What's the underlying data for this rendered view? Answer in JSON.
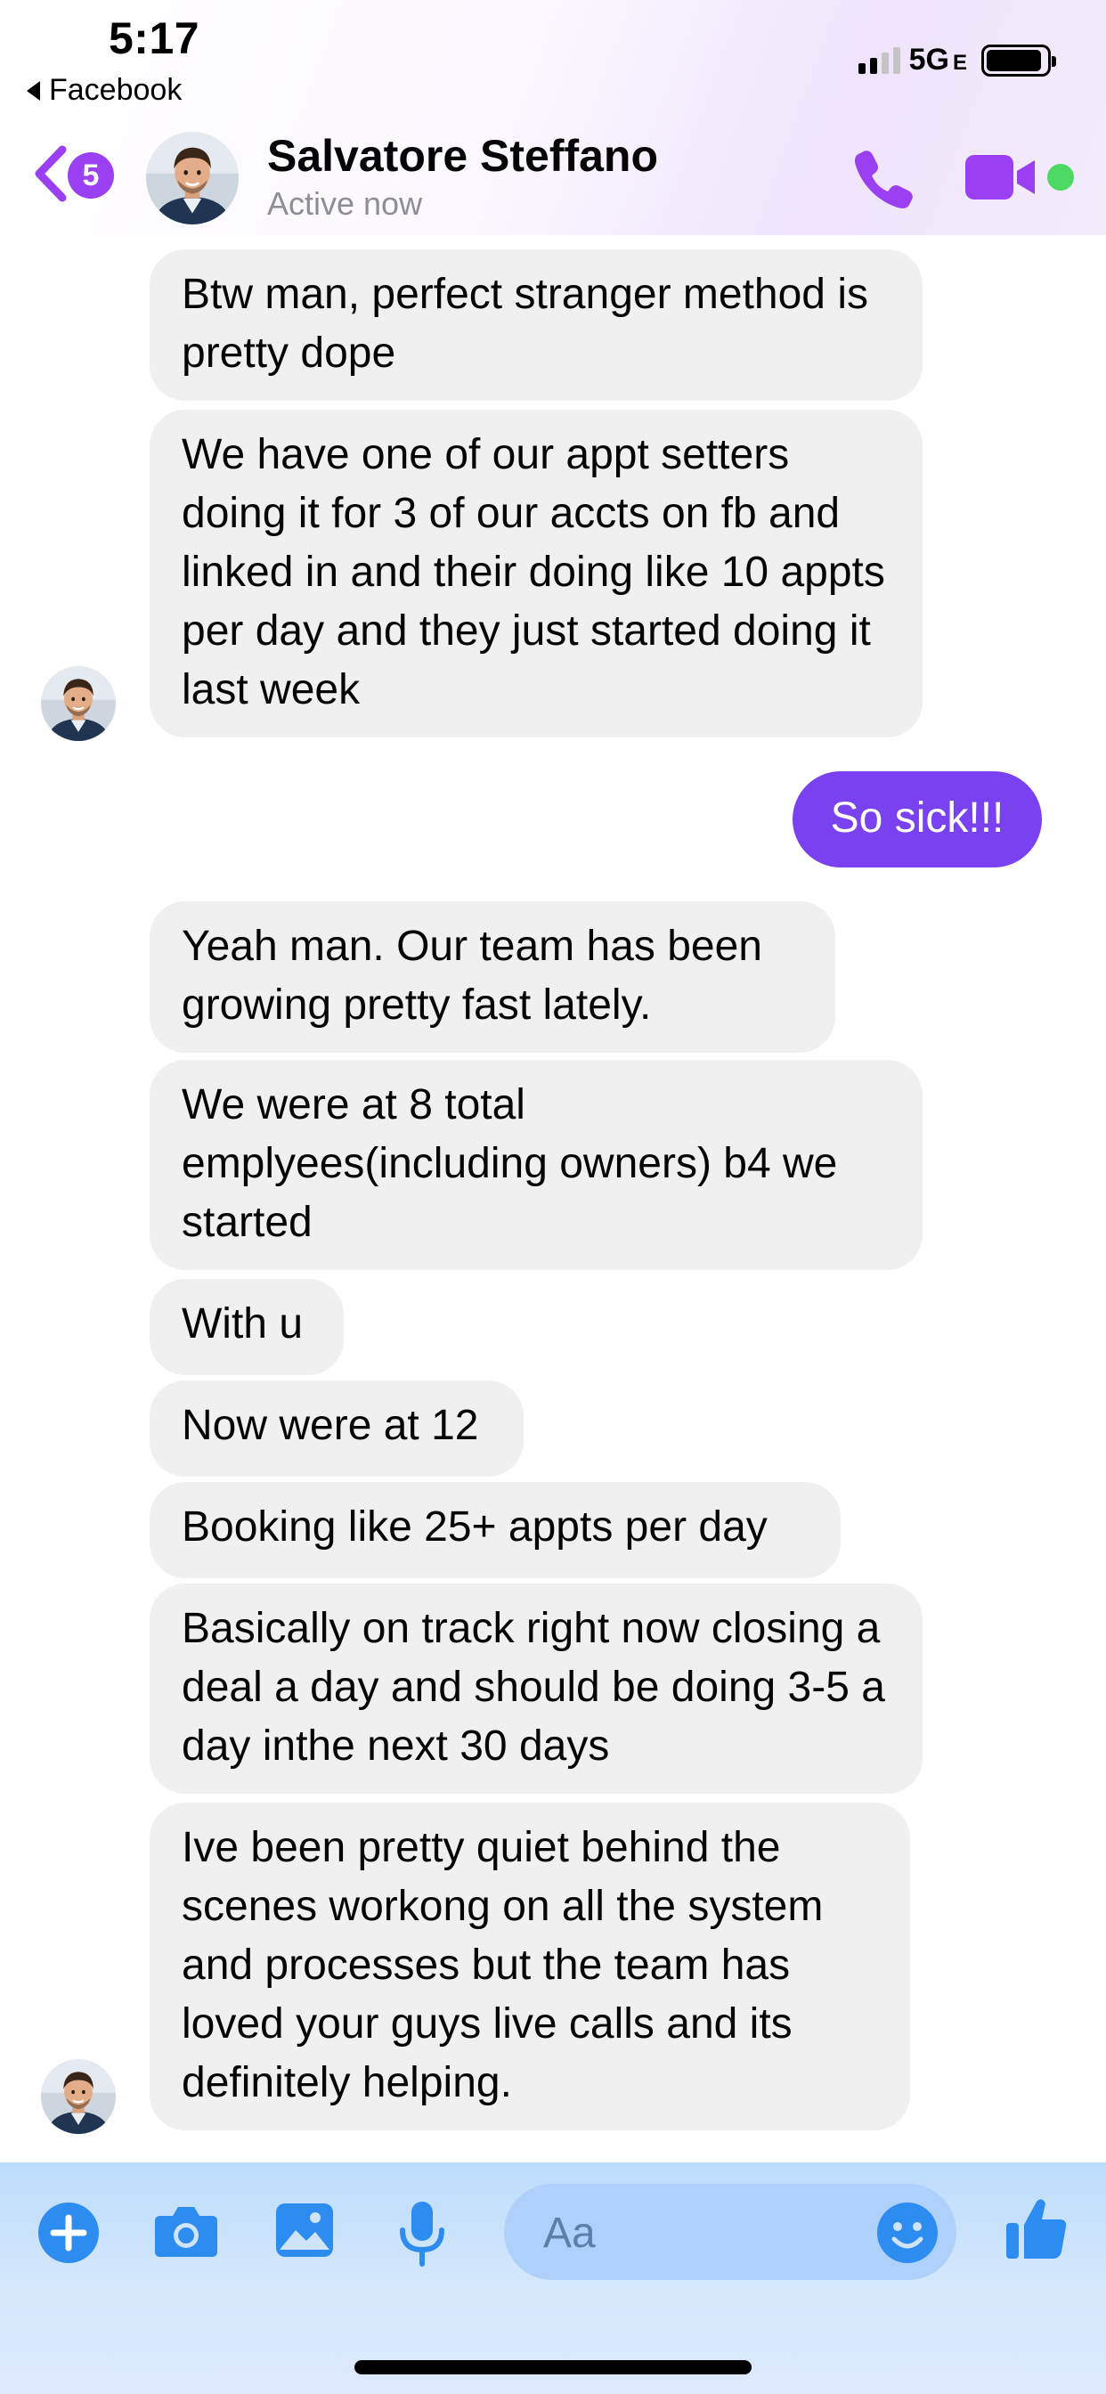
{
  "status_bar": {
    "time": "5:17",
    "back_app_label": "Facebook",
    "network": "5G",
    "network_suffix": "E",
    "signal_bars": 4,
    "signal_bars_active": 2,
    "battery_level_percent": 92
  },
  "header": {
    "back_badge_count": "5",
    "contact_name": "Salvatore Steffano",
    "status": "Active now",
    "online": true,
    "accent_color": "#9b3ff2"
  },
  "messages": [
    {
      "sender": "contact",
      "text": "Btw man, perfect stranger method is pretty dope"
    },
    {
      "sender": "contact",
      "text": "We have one of our appt setters doing it for 3 of our accts on fb and linked in and their doing like 10 appts per day and they just started doing it last week"
    },
    {
      "sender": "me",
      "text": "So sick!!!"
    },
    {
      "sender": "contact",
      "text": "Yeah man. Our team has been growing pretty fast lately."
    },
    {
      "sender": "contact",
      "text": "We were at 8 total emplyees(including owners) b4 we started"
    },
    {
      "sender": "contact",
      "text": "With u"
    },
    {
      "sender": "contact",
      "text": "Now were at 12"
    },
    {
      "sender": "contact",
      "text": "Booking like 25+ appts per day"
    },
    {
      "sender": "contact",
      "text": "Basically on track right now closing a deal a day and should be doing 3-5 a day inthe next 30 days"
    },
    {
      "sender": "contact",
      "text": "Ive been pretty quiet behind the scenes workong on all the system and processes but the team has loved your guys live calls and its definitely helping."
    }
  ],
  "composer": {
    "placeholder": "Aa",
    "icons": [
      "plus-icon",
      "camera-icon",
      "photo-icon",
      "microphone-icon",
      "emoji-icon",
      "thumbs-up-icon"
    ]
  },
  "colors": {
    "outgoing_bubble": "#7a41f1",
    "incoming_bubble": "#f0f0f0",
    "composer_icon": "#2d8cf0"
  }
}
